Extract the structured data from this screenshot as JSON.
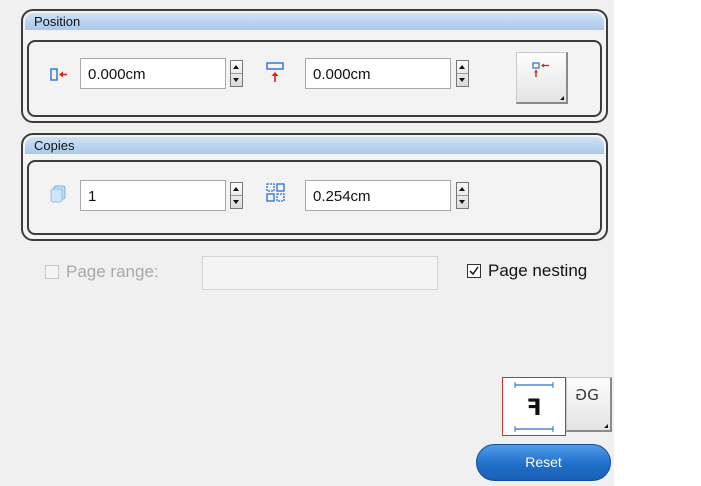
{
  "position": {
    "title": "Position",
    "x_value": "0.000cm",
    "y_value": "0.000cm"
  },
  "copies": {
    "title": "Copies",
    "count_value": "1",
    "spacing_value": "0.254cm"
  },
  "page_range": {
    "label": "Page range:",
    "checked": false,
    "value": ""
  },
  "page_nesting": {
    "label": "Page nesting",
    "checked": true
  },
  "reset": {
    "label": "Reset"
  },
  "icons": {
    "x_offset": "arrow-left-offset-icon",
    "y_offset": "arrow-up-offset-icon",
    "position_options": "position-options-icon",
    "copies_count": "copies-count-icon",
    "copies_spacing": "copies-spacing-icon",
    "orientation": "text-orientation-icon",
    "mirror": "mirror-icon"
  },
  "colors": {
    "accent_red": "#e02020",
    "accent_blue": "#1f6fcc",
    "selected_border": "#d62e2e"
  }
}
